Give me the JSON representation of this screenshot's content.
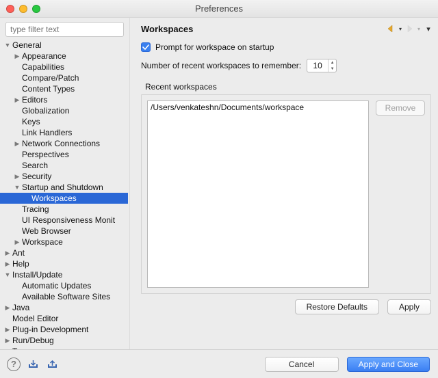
{
  "window": {
    "title": "Preferences"
  },
  "sidebar": {
    "filter_placeholder": "type filter text",
    "items": [
      {
        "label": "General",
        "depth": 0,
        "arrow": "down"
      },
      {
        "label": "Appearance",
        "depth": 1,
        "arrow": "right"
      },
      {
        "label": "Capabilities",
        "depth": 1,
        "arrow": "none"
      },
      {
        "label": "Compare/Patch",
        "depth": 1,
        "arrow": "none"
      },
      {
        "label": "Content Types",
        "depth": 1,
        "arrow": "none"
      },
      {
        "label": "Editors",
        "depth": 1,
        "arrow": "right"
      },
      {
        "label": "Globalization",
        "depth": 1,
        "arrow": "none"
      },
      {
        "label": "Keys",
        "depth": 1,
        "arrow": "none"
      },
      {
        "label": "Link Handlers",
        "depth": 1,
        "arrow": "none"
      },
      {
        "label": "Network Connections",
        "depth": 1,
        "arrow": "right"
      },
      {
        "label": "Perspectives",
        "depth": 1,
        "arrow": "none"
      },
      {
        "label": "Search",
        "depth": 1,
        "arrow": "none"
      },
      {
        "label": "Security",
        "depth": 1,
        "arrow": "right"
      },
      {
        "label": "Startup and Shutdown",
        "depth": 1,
        "arrow": "down"
      },
      {
        "label": "Workspaces",
        "depth": 2,
        "arrow": "none",
        "selected": true
      },
      {
        "label": "Tracing",
        "depth": 1,
        "arrow": "none"
      },
      {
        "label": "UI Responsiveness Monit",
        "depth": 1,
        "arrow": "none"
      },
      {
        "label": "Web Browser",
        "depth": 1,
        "arrow": "none"
      },
      {
        "label": "Workspace",
        "depth": 1,
        "arrow": "right"
      },
      {
        "label": "Ant",
        "depth": 0,
        "arrow": "right"
      },
      {
        "label": "Help",
        "depth": 0,
        "arrow": "right"
      },
      {
        "label": "Install/Update",
        "depth": 0,
        "arrow": "down"
      },
      {
        "label": "Automatic Updates",
        "depth": 1,
        "arrow": "none"
      },
      {
        "label": "Available Software Sites",
        "depth": 1,
        "arrow": "none"
      },
      {
        "label": "Java",
        "depth": 0,
        "arrow": "right"
      },
      {
        "label": "Model Editor",
        "depth": 0,
        "arrow": "none"
      },
      {
        "label": "Plug-in Development",
        "depth": 0,
        "arrow": "right"
      },
      {
        "label": "Run/Debug",
        "depth": 0,
        "arrow": "right"
      },
      {
        "label": "Team",
        "depth": 0,
        "arrow": "right"
      }
    ]
  },
  "content": {
    "section_title": "Workspaces",
    "prompt_checkbox_label": "Prompt for workspace on startup",
    "number_label": "Number of recent workspaces to remember:",
    "number_value": "10",
    "group_label": "Recent workspaces",
    "recent_items": [
      "/Users/venkateshn/Documents/workspace"
    ],
    "remove_btn": "Remove",
    "restore_btn": "Restore Defaults",
    "apply_btn": "Apply"
  },
  "footer": {
    "cancel": "Cancel",
    "apply_close": "Apply and Close"
  }
}
